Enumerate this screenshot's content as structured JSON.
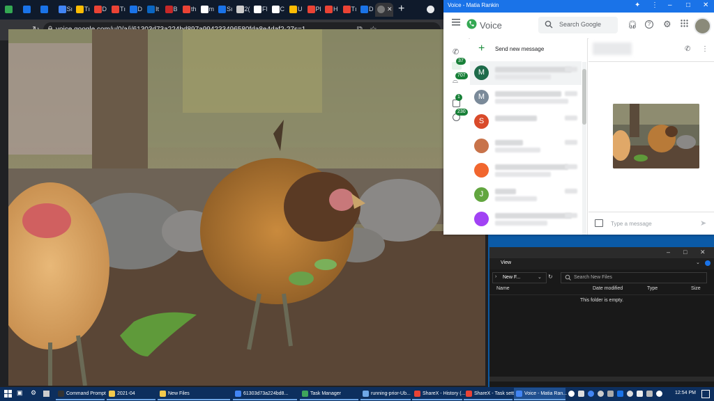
{
  "browser": {
    "url": "voice.google.com/u/0/a/i/61303d73a224bd897a994233496580fda8e4daf2-27s=1",
    "tabs": [
      {
        "label": "",
        "color": "#34a853"
      },
      {
        "label": "",
        "color": "#1a73e8"
      },
      {
        "label": "",
        "color": "#1a73e8"
      },
      {
        "label": "Sı",
        "color": "#4285f4"
      },
      {
        "label": "Tı",
        "color": "#fbbc04"
      },
      {
        "label": "D",
        "color": "#ea4335"
      },
      {
        "label": "Tı",
        "color": "#ea4335"
      },
      {
        "label": "D",
        "color": "#1a73e8"
      },
      {
        "label": "It",
        "color": "#0a66c2"
      },
      {
        "label": "B",
        "color": "#c62828"
      },
      {
        "label": "th",
        "color": "#ea4335"
      },
      {
        "label": "m",
        "color": "#ffffff"
      },
      {
        "label": "Sı",
        "color": "#1a73e8"
      },
      {
        "label": "2(",
        "color": "#cccccc"
      },
      {
        "label": "Fl",
        "color": "#ffffff"
      },
      {
        "label": "C",
        "color": "#ffffff"
      },
      {
        "label": "U",
        "color": "#fbbc04"
      },
      {
        "label": "Pl",
        "color": "#ea4335"
      },
      {
        "label": "H",
        "color": "#ea4335"
      },
      {
        "label": "Tı",
        "color": "#ea4335"
      },
      {
        "label": "D",
        "color": "#1a73e8"
      }
    ]
  },
  "voice": {
    "window_title": "Voice - Matia Rankin",
    "app_name": "Voice",
    "search_placeholder": "Search Google",
    "send_new_message": "Send new message",
    "compose_placeholder": "Type a message",
    "rail_badges": [
      "37",
      "707",
      "1",
      "230"
    ],
    "conversations": [
      {
        "initial": "M",
        "color": "#1e6b4a",
        "w1": 110,
        "w2": 80
      },
      {
        "initial": "M",
        "color": "#7a8a99",
        "w1": 95,
        "w2": 105
      },
      {
        "initial": "S",
        "color": "#d94a2a",
        "w1": 60,
        "w2": 0
      },
      {
        "initial": "",
        "color": "#c8734a",
        "w1": 40,
        "w2": 65
      },
      {
        "initial": "",
        "color": "#f1662e",
        "w1": 105,
        "w2": 80
      },
      {
        "initial": "J",
        "color": "#62a63f",
        "w1": 30,
        "w2": 60
      },
      {
        "initial": "",
        "color": "#a142f4",
        "w1": 110,
        "w2": 75
      }
    ],
    "accent": "#1a73e8",
    "badge_color": "#188038"
  },
  "explorer": {
    "ribbon_view": "View",
    "path": "New F...",
    "search_placeholder": "Search New Files",
    "columns": {
      "name": "Name",
      "date": "Date modified",
      "type": "Type",
      "size": "Size"
    },
    "empty_message": "This folder is empty."
  },
  "taskbar": {
    "items": [
      {
        "label": "Command Prompt",
        "color": "#333333"
      },
      {
        "label": "2021-04",
        "color": "#f2c94c"
      },
      {
        "label": "New Files",
        "color": "#f2c94c"
      },
      {
        "label": "61303d73a224bd8...",
        "color": "#4285f4"
      },
      {
        "label": "Task Manager",
        "color": "#3ea55b"
      },
      {
        "label": "running-prior-Ub...",
        "color": "#6fa8e8"
      },
      {
        "label": "ShareX - History (...",
        "color": "#ea4335"
      },
      {
        "label": "ShareX - Task sett...",
        "color": "#ea4335"
      },
      {
        "label": "Voice - Matia Ran...",
        "color": "#4285f4"
      }
    ],
    "clock": "12:54 PM"
  }
}
